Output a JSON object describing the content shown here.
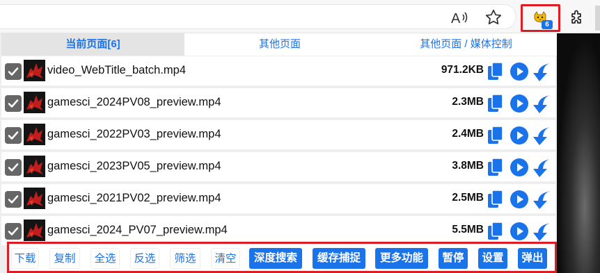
{
  "browser": {
    "read_aloud_label": "A",
    "extension_badge": "6"
  },
  "tabs": [
    {
      "label": "当前页面[6]"
    },
    {
      "label": "其他页面"
    },
    {
      "label": "其他页面 / 媒体控制"
    }
  ],
  "files": [
    {
      "name": "video_WebTitle_batch.mp4",
      "size": "971.2KB",
      "checked": true
    },
    {
      "name": "gamesci_2024PV08_preview.mp4",
      "size": "2.3MB",
      "checked": true
    },
    {
      "name": "gamesci_2022PV03_preview.mp4",
      "size": "2.4MB",
      "checked": true
    },
    {
      "name": "gamesci_2023PV05_preview.mp4",
      "size": "3.8MB",
      "checked": true
    },
    {
      "name": "gamesci_2021PV02_preview.mp4",
      "size": "2.5MB",
      "checked": true
    },
    {
      "name": "gamesci_2024_PV07_preview.mp4",
      "size": "5.5MB",
      "checked": true
    }
  ],
  "buttons": {
    "download": "下载",
    "copy": "复制",
    "select_all": "全选",
    "invert": "反选",
    "filter": "筛选",
    "clear": "清空",
    "deep_search": "深度搜索",
    "cache_capture": "缓存捕捉",
    "more": "更多功能",
    "pause": "暂停",
    "settings": "设置",
    "popout": "弹出"
  },
  "colors": {
    "accent": "#1a73e8",
    "highlight_border": "#e01b24",
    "checkbox": "#666666"
  }
}
